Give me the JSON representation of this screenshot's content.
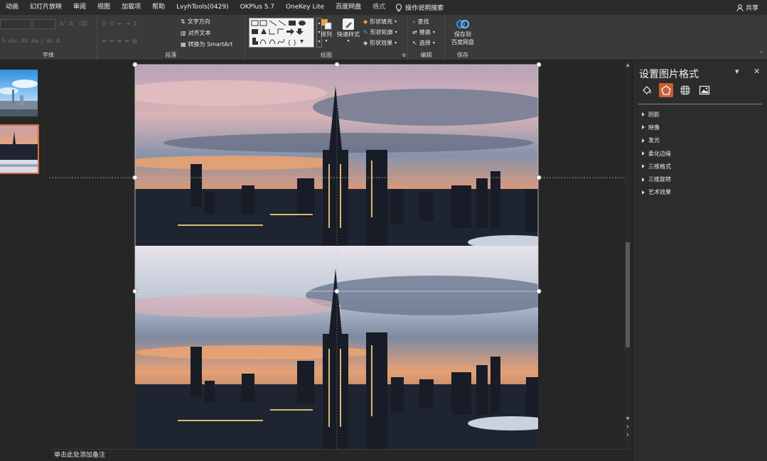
{
  "menu": {
    "items": [
      "动画",
      "幻灯片放映",
      "审阅",
      "视图",
      "加载项",
      "帮助",
      "LvyhTools(0429)",
      "OKPlus 5.7",
      "OneKey Lite",
      "百度网盘",
      "格式"
    ],
    "search_label": "操作说明搜索",
    "share_label": "共享"
  },
  "ribbon": {
    "font_group_label": "字体",
    "paragraph_group_label": "段落",
    "paragraph_text_direction": "文字方向",
    "paragraph_align_text": "对齐文本",
    "paragraph_smartart": "转换为 SmartArt",
    "drawing_group_label": "绘图",
    "arrange_label": "排列",
    "quick_styles_label": "快速样式",
    "shape_fill_label": "形状填充",
    "shape_outline_label": "形状轮廓",
    "shape_effects_label": "形状效果",
    "editing_group_label": "编辑",
    "find_label": "查找",
    "replace_label": "替换",
    "select_label": "选择",
    "save_group_label": "保存",
    "save_baidu_line1": "保存到",
    "save_baidu_line2": "百度网盘"
  },
  "notes_placeholder": "单击此处添加备注",
  "pane": {
    "title": "设置图片格式",
    "dropdown_icon": "▾",
    "close_icon": "✕",
    "sections": [
      "阴影",
      "映像",
      "发光",
      "柔化边缘",
      "三维格式",
      "三维旋转",
      "艺术效果"
    ]
  },
  "colors": {
    "accent": "#c8602f",
    "thumb_selected": "#d86b3e",
    "ribbon_bg": "#3a3a3a",
    "canvas_bg": "#262626"
  }
}
